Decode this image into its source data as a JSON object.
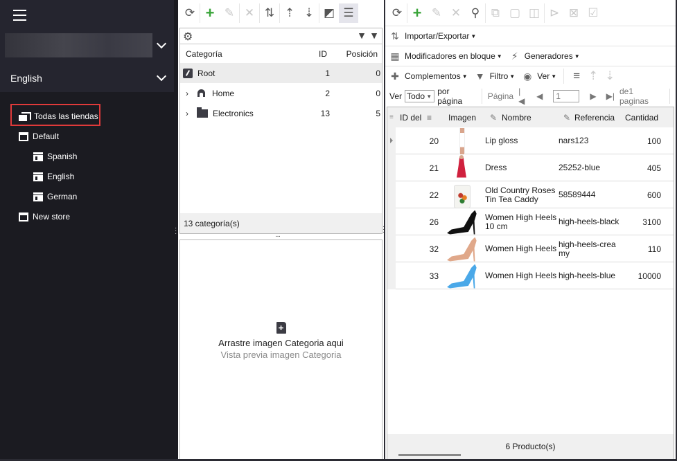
{
  "sidebar": {
    "store_selector_value": "",
    "language": "English",
    "tree": [
      {
        "label": "Todas las tiendas",
        "icon": "multi-store-icon",
        "level": 0,
        "selected": true
      },
      {
        "label": "Default",
        "icon": "store-window-icon",
        "level": 1
      },
      {
        "label": "Spanish",
        "icon": "shop-icon",
        "level": 2
      },
      {
        "label": "English",
        "icon": "shop-icon",
        "level": 2
      },
      {
        "label": "German",
        "icon": "shop-icon",
        "level": 2
      },
      {
        "label": "New store",
        "icon": "store-window-icon",
        "level": 1
      }
    ]
  },
  "categories": {
    "toolbar": [
      "refresh-icon",
      "add-icon",
      "edit-icon",
      "delete-icon",
      "import-export-icon",
      "move-up-icon",
      "move-down-icon",
      "expand-collapse-icon",
      "filter-list-icon"
    ],
    "columns": {
      "name": "Categoría",
      "id": "ID",
      "position": "Posición"
    },
    "rows": [
      {
        "name": "Root",
        "id": "1",
        "position": "0",
        "icon": "root-icon",
        "selected": true
      },
      {
        "name": "Home",
        "id": "2",
        "position": "0",
        "icon": "home-icon",
        "expandable": true
      },
      {
        "name": "Electronics",
        "id": "13",
        "position": "5",
        "icon": "folder-icon",
        "expandable": true
      }
    ],
    "footer": "13 categoría(s)",
    "image_drop": {
      "title": "Arrastre imagen Categoria aqui",
      "subtitle": "Vista previa imagen Categoria"
    }
  },
  "products": {
    "toolbar_row1": [
      "refresh-icon",
      "add-icon",
      "edit-icon",
      "delete-icon",
      "search-icon",
      "copy-icon",
      "paste-icon",
      "duplicate-icon",
      "move-to-category-icon",
      "remove-from-category-icon",
      "assign-category-icon"
    ],
    "import_export": "Importar/Exportar",
    "bulk_modifiers": "Modificadores en bloque",
    "generators": "Generadores",
    "addons": "Complementos",
    "filter": "Filtro",
    "view": "Ver",
    "pager": {
      "show_label": "Ver",
      "per_page_value": "Todo",
      "per_page_label": "por página",
      "page_label": "Página",
      "current_page": "1",
      "of_pages": "de1 paginas"
    },
    "columns": {
      "id": "ID del",
      "image": "Imagen",
      "name": "Nombre",
      "reference": "Referencia",
      "quantity": "Cantidad"
    },
    "rows": [
      {
        "id": "20",
        "name": "Lip gloss",
        "reference": "nars123",
        "quantity": "100",
        "thumb": "lip-gloss",
        "current": true
      },
      {
        "id": "21",
        "name": "Dress",
        "reference": "25252-blue",
        "quantity": "405",
        "thumb": "dress"
      },
      {
        "id": "22",
        "name": "Old Country Roses Tin Tea Caddy",
        "reference": "58589444",
        "quantity": "600",
        "thumb": "tea-caddy"
      },
      {
        "id": "26",
        "name": "Women High Heels 10 cm",
        "reference": "high-heels-black",
        "quantity": "3100",
        "thumb": "heel-black"
      },
      {
        "id": "32",
        "name": "Women High Heels",
        "reference": "high-heels-creamy",
        "quantity": "110",
        "thumb": "heel-nude"
      },
      {
        "id": "33",
        "name": "Women High Heels",
        "reference": "high-heels-blue",
        "quantity": "10000",
        "thumb": "heel-blue"
      }
    ],
    "footer": "6 Producto(s)"
  },
  "colors": {
    "sidebar_bg": "#1b1b21",
    "selection_outline": "#e03a3a",
    "add_green": "#3aa53a"
  }
}
